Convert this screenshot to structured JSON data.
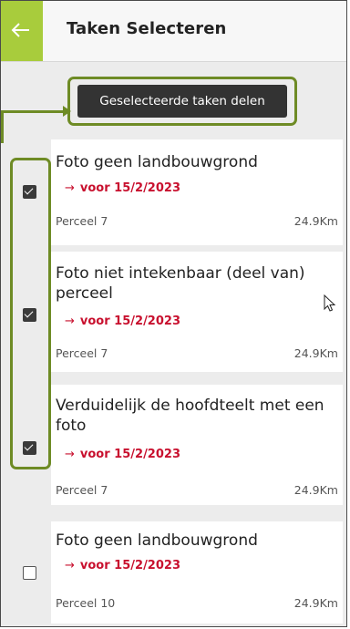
{
  "header": {
    "title": "Taken Selecteren",
    "accent_color": "#a8cc3c",
    "back_icon": "arrow-left-icon"
  },
  "toolbar": {
    "share_label": "Geselecteerde taken delen"
  },
  "highlight_color": "#6e8b25",
  "tasks": [
    {
      "title": "Foto geen landbouwgrond",
      "deadline": "voor 15/2/2023",
      "parcel": "Perceel 7",
      "distance": "24.9Km",
      "checked": true
    },
    {
      "title": "Foto niet intekenbaar (deel van) perceel",
      "deadline": "voor 15/2/2023",
      "parcel": "Perceel 7",
      "distance": "24.9Km",
      "checked": true
    },
    {
      "title": "Verduidelijk de hoofdteelt met een foto",
      "deadline": "voor 15/2/2023",
      "parcel": "Perceel 7",
      "distance": "24.9Km",
      "checked": true
    },
    {
      "title": "Foto geen landbouwgrond",
      "deadline": "voor 15/2/2023",
      "parcel": "Perceel 10",
      "distance": "24.9Km",
      "checked": false
    }
  ]
}
